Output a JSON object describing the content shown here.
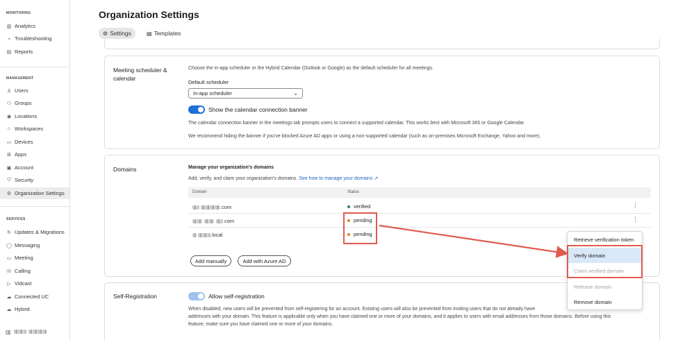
{
  "sidebar": {
    "sections": {
      "monitoring": "MONITORING",
      "management": "MANAGEMENT",
      "services": "SERVICES"
    },
    "monitoring_items": [
      "Analytics",
      "Troubleshooting",
      "Reports"
    ],
    "management_items": [
      "Users",
      "Groups",
      "Locations",
      "Workspaces",
      "Devices",
      "Apps",
      "Account",
      "Security",
      "Organization Settings"
    ],
    "services_items": [
      "Updates & Migrations",
      "Messaging",
      "Meeting",
      "Calling",
      "Vidcast",
      "Connected UC",
      "Hybrid"
    ],
    "active_item": "Organization Settings"
  },
  "header": {
    "title": "Organization Settings",
    "tabs": [
      {
        "label": "Settings",
        "icon": "gear-icon",
        "active": true
      },
      {
        "label": "Templates",
        "icon": "document-icon",
        "active": false
      }
    ]
  },
  "meeting": {
    "title": "Meeting scheduler & calendar",
    "description": "Choose the in-app scheduler or the Hybrid Calendar (Outlook or Google) as the default scheduler for all meetings.",
    "default_label": "Default scheduler",
    "scheduler_value": "In-app scheduler",
    "toggle_label": "Show the calendar connection banner",
    "toggle_on": true,
    "note1": "The calendar connection banner in the meetings tab prompts users to connect a supported calendar. This works best with Microsoft 365 or Google Calendar.",
    "note2": "We recommend hiding the banner if you've blocked Azure AD apps or using a non-supported calendar (such as on-premises Microsoft Exchange, Yahoo and more)."
  },
  "domains": {
    "title": "Domains",
    "subtitle": "Manage your organization's domains",
    "description": "Add, verify, and claim your organization's domains.",
    "help_link": "See how to manage your domains",
    "columns": {
      "domain": "Domain",
      "status": "Status"
    },
    "rows": [
      {
        "domain_suffix": ".com",
        "status": "verified",
        "status_color": "#1d8a5a"
      },
      {
        "domain_suffix": "com",
        "status": "pending",
        "status_color": "#e0821f"
      },
      {
        "domain_suffix": ".local",
        "status": "pending",
        "status_color": "#e0821f"
      }
    ],
    "add_manually": "Add manually",
    "add_azure": "Add with Azure AD"
  },
  "context_menu": {
    "items": [
      {
        "label": "Retrieve verification token",
        "state": "normal"
      },
      {
        "label": "Verify domain",
        "state": "hover"
      },
      {
        "label": "Claim verified domain",
        "state": "disabled"
      },
      {
        "label": "Release domain",
        "state": "disabled"
      },
      {
        "label": "Remove domain",
        "state": "normal"
      }
    ]
  },
  "self_registration": {
    "title": "Self-Registration",
    "toggle_label": "Allow self-registration",
    "desc1": "When disabled, new users will be prevented from self-registering for an account. Existing users will also be prevented from inviting users that do not already have",
    "desc2": "addresses with your domain. This feature is applicable only when you have claimed one or more of your domains, and it applies to users with email addresses from those domains. Before using this",
    "desc3": "feature, make sure you have claimed one or more of your domains."
  },
  "colors": {
    "accent": "#1e6fd6",
    "highlight": "#e05a4f",
    "verified": "#1d8a5a",
    "pending": "#e0821f"
  }
}
